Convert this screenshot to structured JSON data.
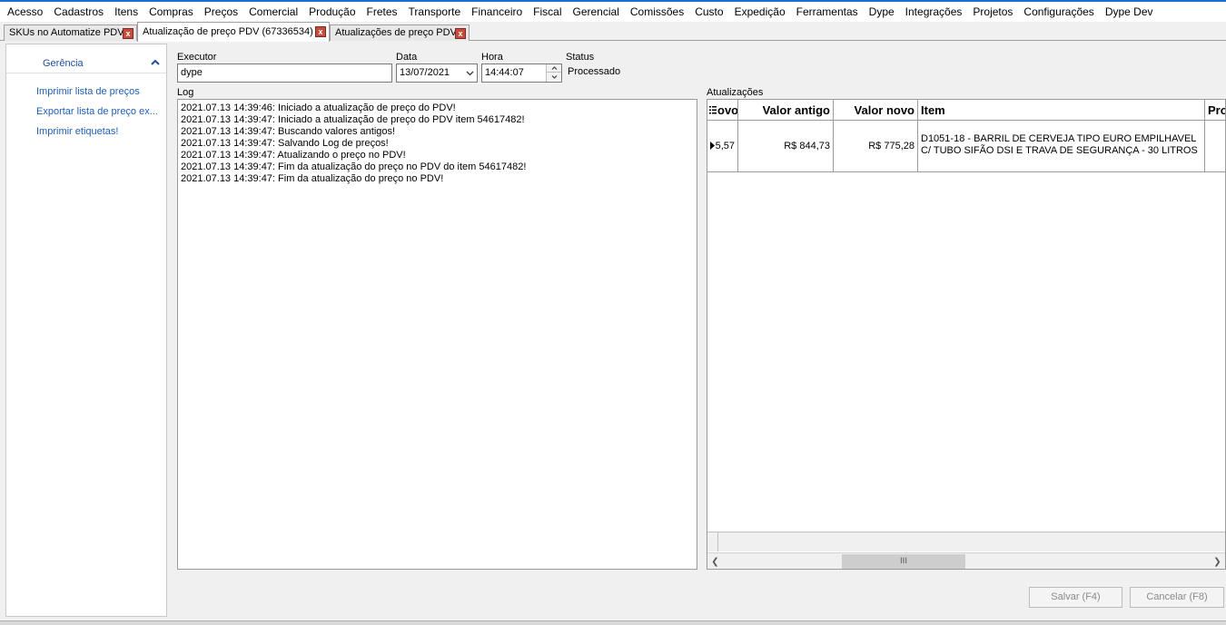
{
  "menu": [
    "Acesso",
    "Cadastros",
    "Itens",
    "Compras",
    "Preços",
    "Comercial",
    "Produção",
    "Fretes",
    "Transporte",
    "Financeiro",
    "Fiscal",
    "Gerencial",
    "Comissões",
    "Custo",
    "Expedição",
    "Ferramentas",
    "Dype",
    "Integrações",
    "Projetos",
    "Configurações",
    "Dype Dev"
  ],
  "tabs": [
    {
      "label": "SKUs no Automatize PDV",
      "close": "x"
    },
    {
      "label": "Atualização de preço PDV (67336534)",
      "close": "x"
    },
    {
      "label": "Atualizações de preço PDV",
      "close": "x"
    }
  ],
  "sidebar": {
    "title": "Gerência",
    "links": [
      "Imprimir lista de preços",
      "Exportar lista de preço ex...",
      "Imprimir etiquetas!"
    ]
  },
  "form": {
    "executor_label": "Executor",
    "executor_value": "dype",
    "data_label": "Data",
    "data_value": "13/07/2021",
    "hora_label": "Hora",
    "hora_value": "14:44:07",
    "status_label": "Status",
    "status_value": "Processado"
  },
  "log": {
    "label": "Log",
    "lines": [
      "2021.07.13 14:39:46: Iniciado a atualização de preço do PDV!",
      "2021.07.13 14:39:47: Iniciado a atualização de preço do PDV item 54617482!",
      "2021.07.13 14:39:47: Buscando valores antigos!",
      "2021.07.13 14:39:47: Salvando Log de preços!",
      "2021.07.13 14:39:47: Atualizando o preço no PDV!",
      "2021.07.13 14:39:47: Fim da atualização do preço no PDV do item 54617482!",
      "2021.07.13 14:39:47: Fim da atualização do preço no PDV!"
    ]
  },
  "grid": {
    "label": "Atualizações",
    "columns": [
      "ovo",
      "Valor antigo",
      "Valor novo",
      "Item",
      "Pro"
    ],
    "rows": [
      {
        "c0": "5,57",
        "valor_antigo": "R$ 844,73",
        "valor_novo": "R$ 775,28",
        "item": "D1051-18 - BARRIL DE CERVEJA TIPO EURO EMPILHAVEL C/ TUBO SIFÃO DSI E TRAVA DE SEGURANÇA - 30 LITROS",
        "pro": ""
      }
    ],
    "scroll_grip": "III"
  },
  "buttons": {
    "save": "Salvar (F4)",
    "cancel": "Cancelar (F8)"
  }
}
